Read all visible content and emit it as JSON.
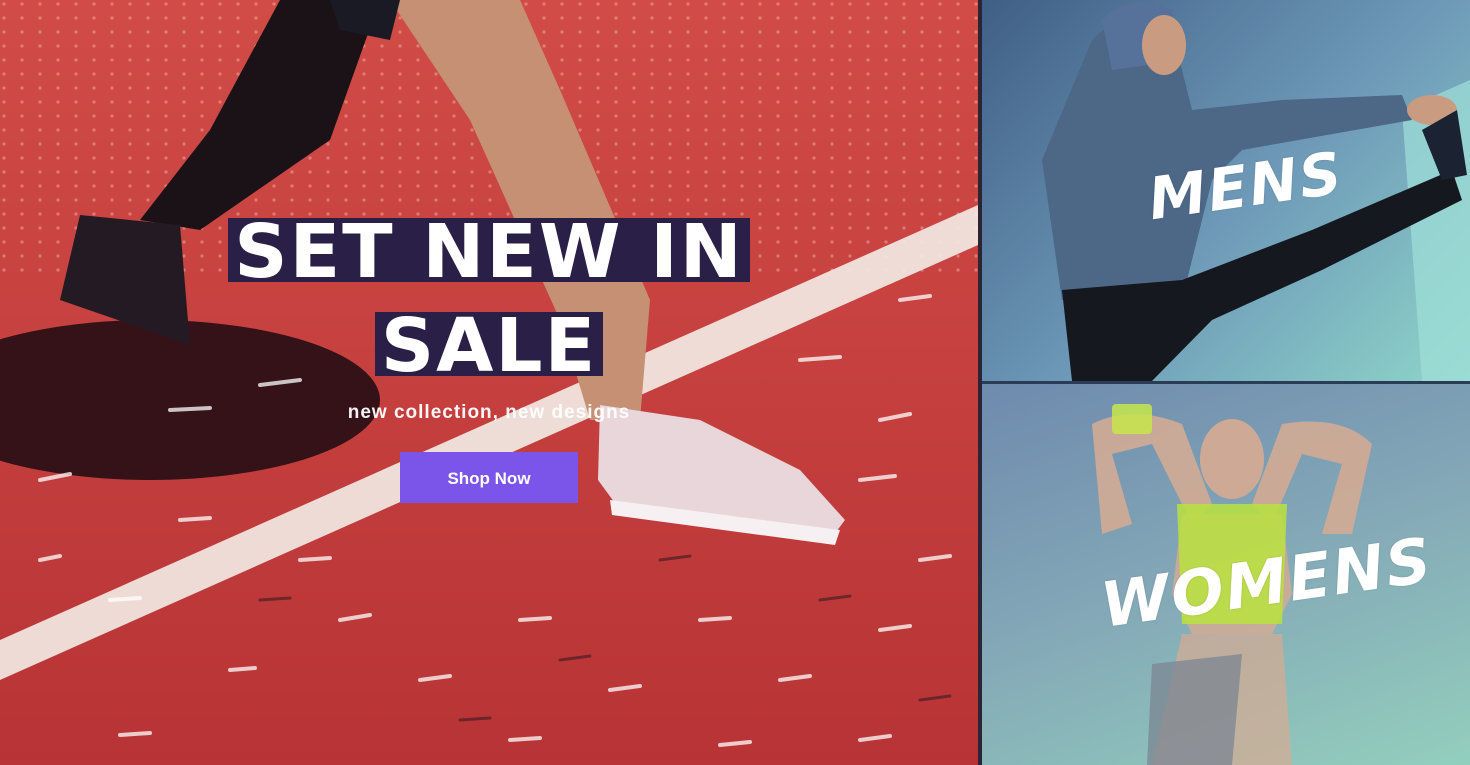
{
  "hero": {
    "title_line1": "SET NEW IN",
    "title_line2": "SALE",
    "subtitle": "new collection, new designs",
    "cta_label": "Shop Now"
  },
  "categories": {
    "mens_label": "MENS",
    "womens_label": "WOMENS"
  },
  "colors": {
    "hero_background": "#c8423f",
    "title_highlight": "#2a2047",
    "cta_button": "#7b55ea"
  }
}
